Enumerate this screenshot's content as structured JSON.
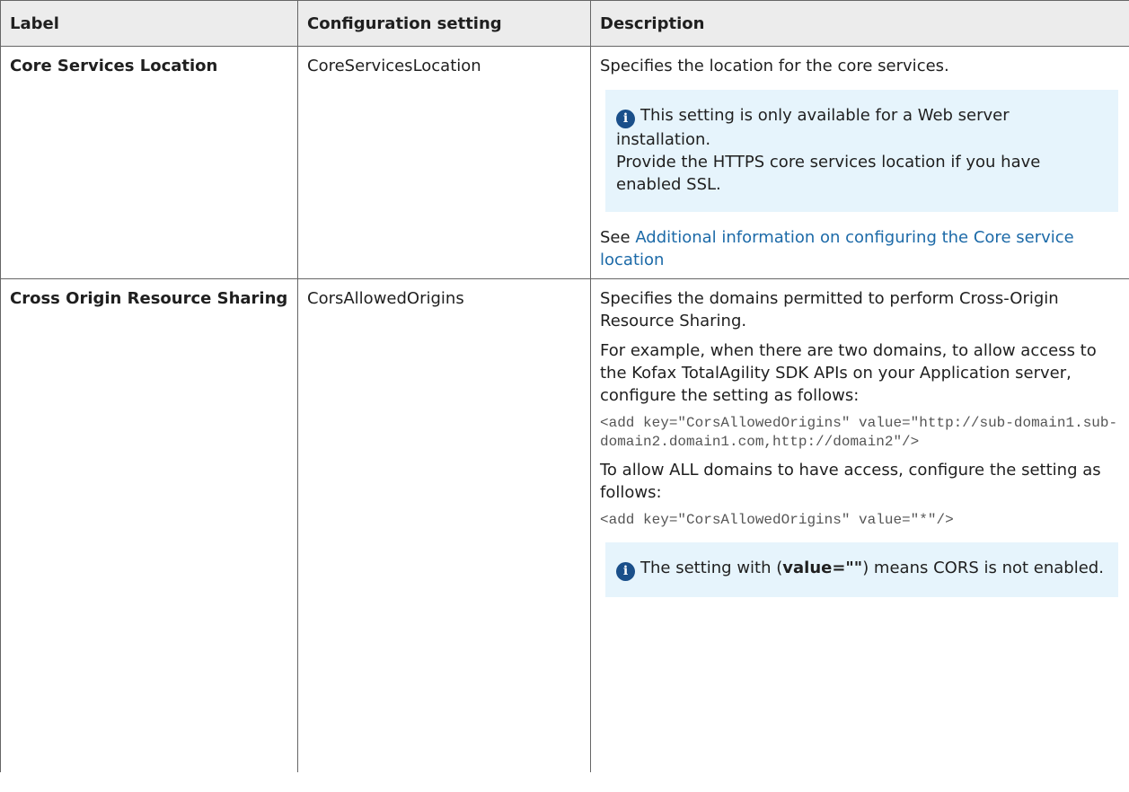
{
  "headers": {
    "label": "Label",
    "config": "Configuration setting",
    "description": "Description"
  },
  "rows": [
    {
      "label": "Core Services Location",
      "config": "CoreServicesLocation",
      "intro": "Specifies the location for the core services.",
      "note_line1": "This setting is only available for a Web server installation.",
      "note_line2": "Provide the HTTPS core services location if you have enabled SSL.",
      "see_prefix": "See",
      "see_link": "Additional information on configuring the Core service location"
    },
    {
      "label": "Cross Origin Resource Sharing",
      "config": "CorsAllowedOrigins",
      "intro": "Specifies the domains permitted to perform Cross-Origin Resource Sharing.",
      "example": "For example, when there are two domains, to allow access to the Kofax TotalAgility SDK APIs on your Application server, configure the setting as follows:",
      "code1": "<add key=\"CorsAllowedOrigins\" value=\"http://sub-domain1.sub-domain2.domain1.com,http://domain2\"/>",
      "all_domains": "To allow ALL domains to have access, configure the setting as follows:",
      "code2": "<add key=\"CorsAllowedOrigins\" value=\"*\"/>",
      "note_prefix": "The setting with (",
      "note_bold": "value=\"\"",
      "note_suffix": ") means CORS is not enabled."
    }
  ],
  "icons": {
    "info": "info-icon"
  },
  "colors": {
    "header_bg": "#ececec",
    "note_bg": "#e6f4fc",
    "link": "#1c6aa8",
    "icon": "#1a4f8a"
  }
}
